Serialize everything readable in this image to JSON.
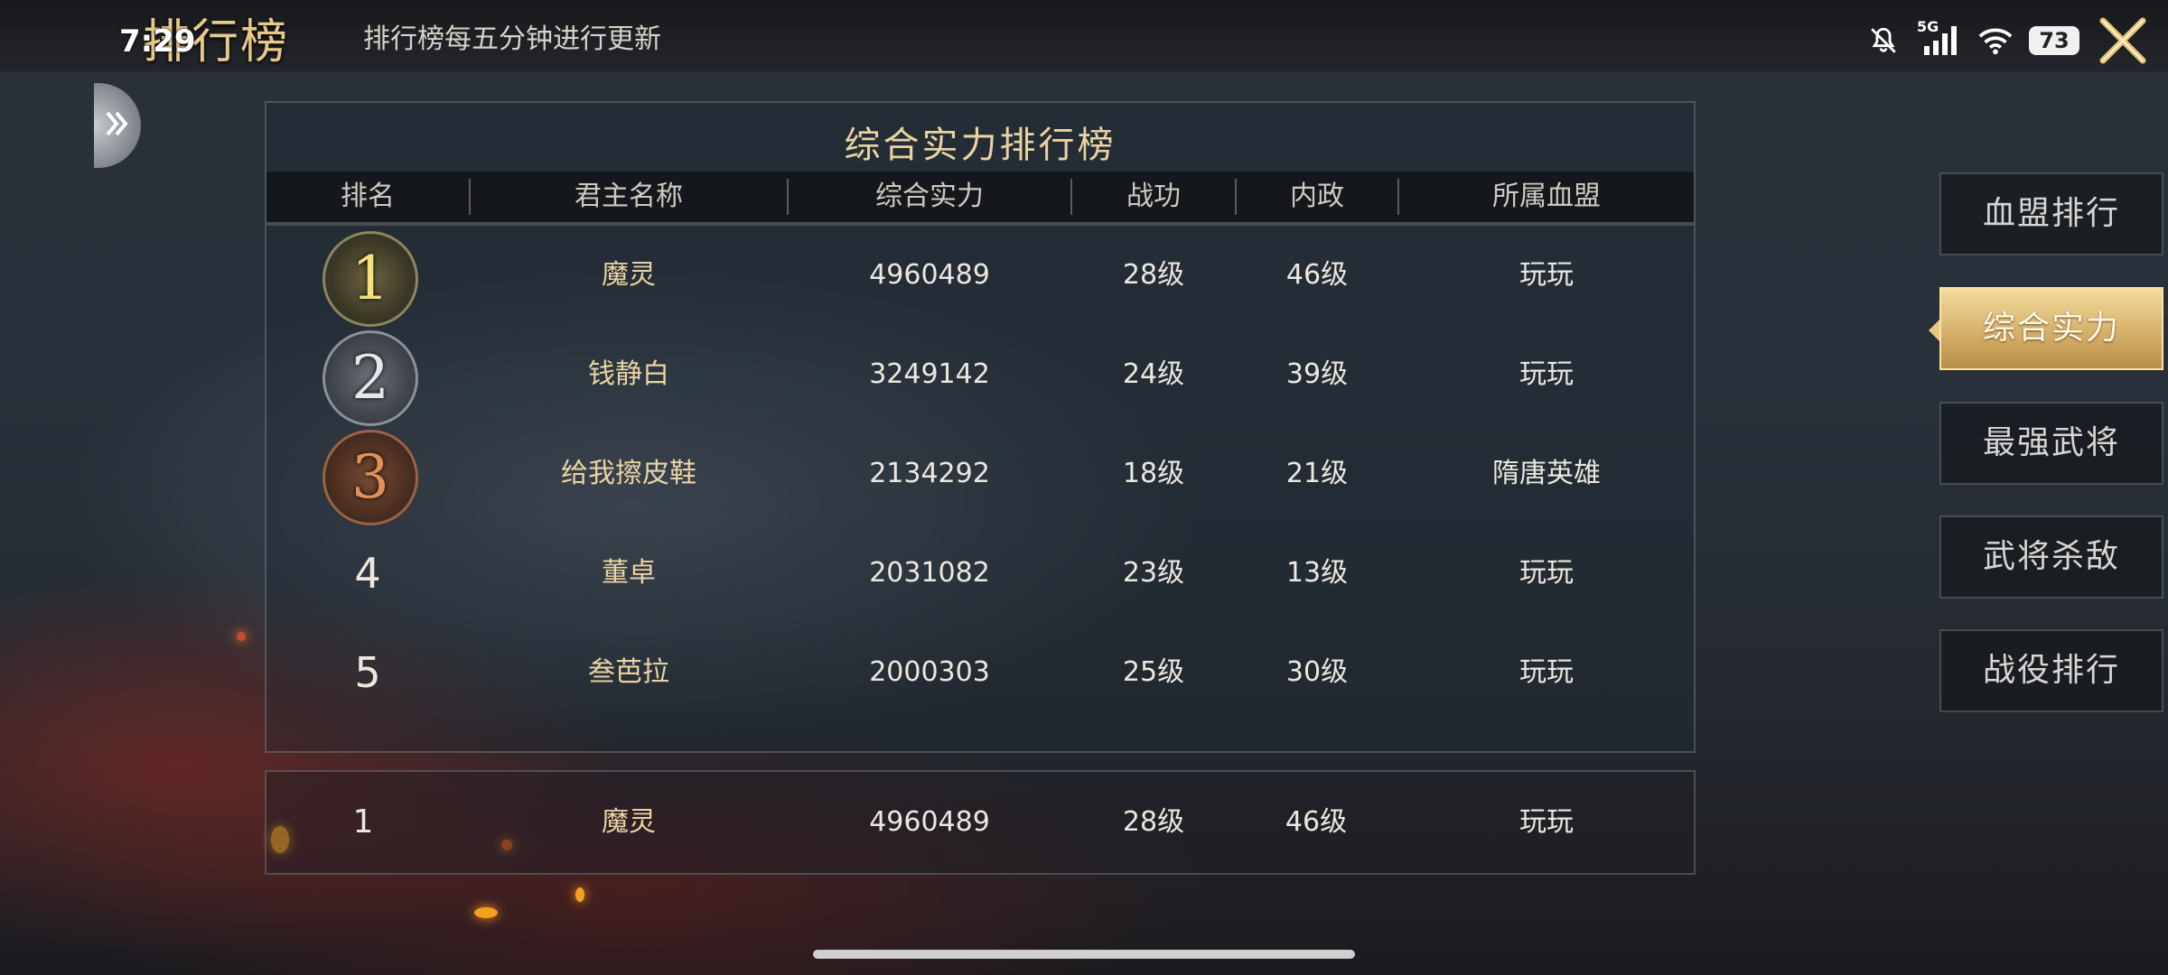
{
  "status_bar": {
    "time": "7:29",
    "network": "5G",
    "battery": "73"
  },
  "header": {
    "title": "排行榜",
    "subtitle": "排行榜每五分钟进行更新"
  },
  "panel": {
    "title": "综合实力排行榜",
    "columns": [
      "排名",
      "君主名称",
      "综合实力",
      "战功",
      "内政",
      "所属血盟"
    ],
    "rows": [
      {
        "rank": "1",
        "name": "魔灵",
        "power": "4960489",
        "merit": "28级",
        "admin": "46级",
        "alliance": "玩玩"
      },
      {
        "rank": "2",
        "name": "钱静白",
        "power": "3249142",
        "merit": "24级",
        "admin": "39级",
        "alliance": "玩玩"
      },
      {
        "rank": "3",
        "name": "给我擦皮鞋",
        "power": "2134292",
        "merit": "18级",
        "admin": "21级",
        "alliance": "隋唐英雄"
      },
      {
        "rank": "4",
        "name": "董卓",
        "power": "2031082",
        "merit": "23级",
        "admin": "13级",
        "alliance": "玩玩"
      },
      {
        "rank": "5",
        "name": "叁芭拉",
        "power": "2000303",
        "merit": "25级",
        "admin": "30级",
        "alliance": "玩玩"
      }
    ]
  },
  "my_rank": {
    "rank": "1",
    "name": "魔灵",
    "power": "4960489",
    "merit": "28级",
    "admin": "46级",
    "alliance": "玩玩"
  },
  "tabs": [
    {
      "label": "血盟排行",
      "active": false
    },
    {
      "label": "综合实力",
      "active": true
    },
    {
      "label": "最强武将",
      "active": false
    },
    {
      "label": "武将杀敌",
      "active": false
    },
    {
      "label": "战役排行",
      "active": false
    }
  ],
  "colors": {
    "gold": "#ead3a3",
    "medal_gold": "#e8d068",
    "medal_silver": "#d8dbe0",
    "medal_bronze": "#d08050",
    "active_tab": "#d6b06a"
  }
}
